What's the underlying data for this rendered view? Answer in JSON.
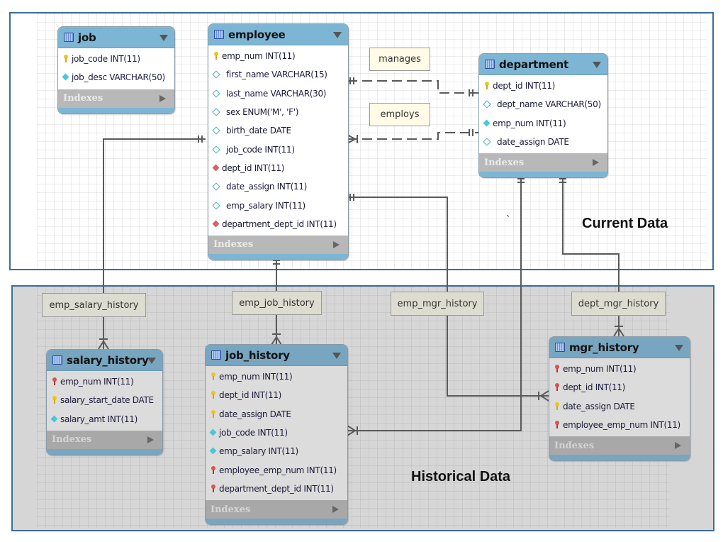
{
  "regions": {
    "current": {
      "title": "Current Data",
      "border_color": "#3c6e9a",
      "bg_color": "#ffffff"
    },
    "historical": {
      "title": "Historical Data",
      "border_color": "#3c6e9a",
      "bg_color": "#d6d6d6"
    }
  },
  "stray_mark": "`",
  "index_label": "Indexes",
  "tables": {
    "job": {
      "name": "job",
      "columns": [
        {
          "icon": "pk",
          "text": "job_code INT(11)"
        },
        {
          "icon": "nn",
          "text": "job_desc VARCHAR(50)"
        }
      ]
    },
    "employee": {
      "name": "employee",
      "columns": [
        {
          "icon": "pk",
          "text": "emp_num INT(11)"
        },
        {
          "icon": "col",
          "text": "first_name VARCHAR(15)"
        },
        {
          "icon": "col",
          "text": "last_name VARCHAR(30)"
        },
        {
          "icon": "col",
          "text": "sex ENUM('M', 'F')"
        },
        {
          "icon": "col",
          "text": "birth_date DATE"
        },
        {
          "icon": "col",
          "text": "job_code INT(11)"
        },
        {
          "icon": "fk",
          "text": "dept_id INT(11)"
        },
        {
          "icon": "col",
          "text": "date_assign INT(11)"
        },
        {
          "icon": "col",
          "text": "emp_salary INT(11)"
        },
        {
          "icon": "fk",
          "text": "department_dept_id INT(11)"
        }
      ]
    },
    "department": {
      "name": "department",
      "columns": [
        {
          "icon": "pk",
          "text": "dept_id INT(11)"
        },
        {
          "icon": "col",
          "text": "dept_name VARCHAR(50)"
        },
        {
          "icon": "nn",
          "text": "emp_num INT(11)"
        },
        {
          "icon": "col",
          "text": "date_assign DATE"
        }
      ]
    },
    "salary_history": {
      "name": "salary_history",
      "columns": [
        {
          "icon": "fkpk",
          "text": "emp_num INT(11)"
        },
        {
          "icon": "pk",
          "text": "salary_start_date DATE"
        },
        {
          "icon": "nn",
          "text": "salary_amt INT(11)"
        }
      ]
    },
    "job_history": {
      "name": "job_history",
      "columns": [
        {
          "icon": "pk",
          "text": "emp_num INT(11)"
        },
        {
          "icon": "pk",
          "text": "dept_id INT(11)"
        },
        {
          "icon": "pk",
          "text": "date_assign DATE"
        },
        {
          "icon": "nn",
          "text": "job_code INT(11)"
        },
        {
          "icon": "nn",
          "text": "emp_salary INT(11)"
        },
        {
          "icon": "fkpk",
          "text": "employee_emp_num INT(11)"
        },
        {
          "icon": "fkpk",
          "text": "department_dept_id INT(11)"
        }
      ]
    },
    "mgr_history": {
      "name": "mgr_history",
      "columns": [
        {
          "icon": "fkpk",
          "text": "emp_num INT(11)"
        },
        {
          "icon": "fkpk",
          "text": "dept_id INT(11)"
        },
        {
          "icon": "pk",
          "text": "date_assign DATE"
        },
        {
          "icon": "fkpk",
          "text": "employee_emp_num INT(11)"
        }
      ]
    }
  },
  "relationships": {
    "manages": "manages",
    "employs": "employs",
    "emp_salary_history": "emp_salary_history",
    "emp_job_history": "emp_job_history",
    "emp_mgr_history": "emp_mgr_history",
    "dept_mgr_history": "dept_mgr_history"
  }
}
